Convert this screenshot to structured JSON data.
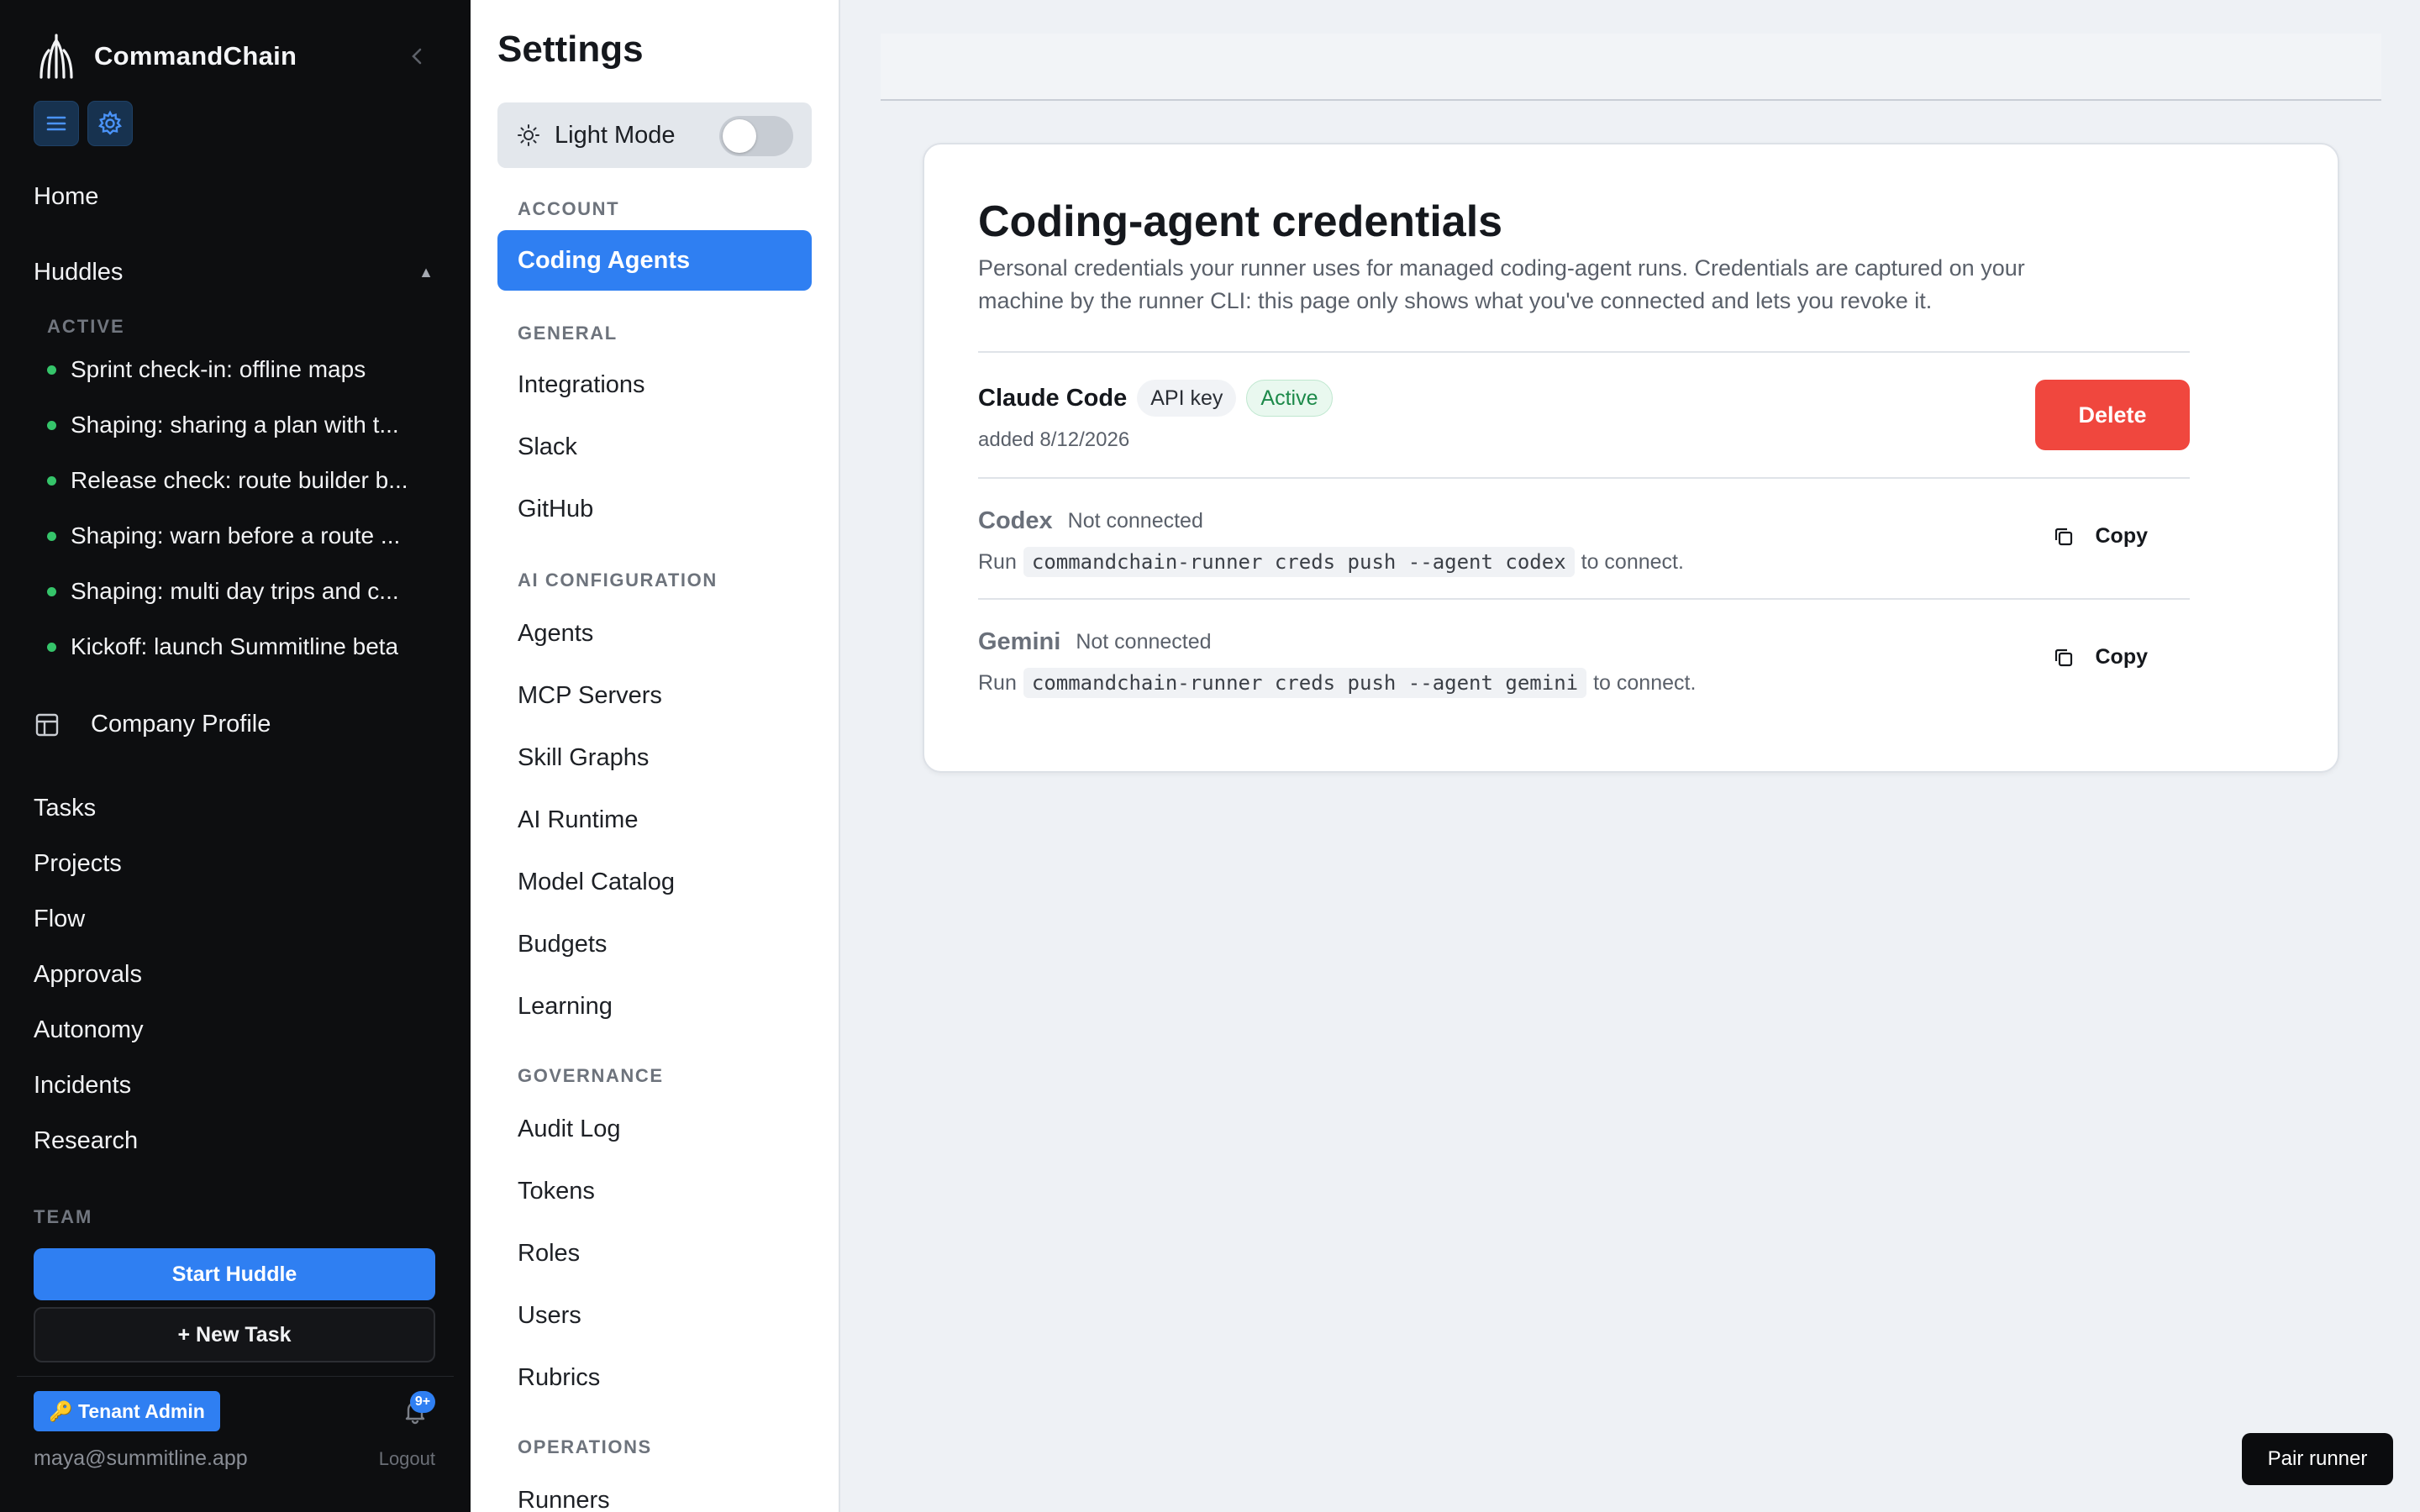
{
  "brand": {
    "name": "CommandChain"
  },
  "sidebar": {
    "home": "Home",
    "huddles": {
      "label": "Huddles",
      "active_caption": "ACTIVE"
    },
    "huddle_items": [
      "Sprint check-in: offline maps",
      "Shaping: sharing a plan with t...",
      "Release check: route builder b...",
      "Shaping: warn before a route ...",
      "Shaping: multi day trips and c...",
      "Kickoff: launch Summitline beta"
    ],
    "company_profile": "Company Profile",
    "nav_items": [
      "Tasks",
      "Projects",
      "Flow",
      "Approvals",
      "Autonomy",
      "Incidents",
      "Research"
    ],
    "team_caption": "TEAM",
    "start_huddle": "Start Huddle",
    "new_task": "+ New Task",
    "tenant_badge": "🔑 Tenant Admin",
    "notification_count": "9+",
    "email": "maya@summitline.app",
    "logout": "Logout"
  },
  "settings": {
    "title": "Settings",
    "mode_label": "Light Mode",
    "account_caption": "ACCOUNT",
    "active_item": "Coding Agents",
    "general_caption": "GENERAL",
    "general_items": [
      "Integrations",
      "Slack",
      "GitHub"
    ],
    "ai_caption": "AI CONFIGURATION",
    "ai_items": [
      "Agents",
      "MCP Servers",
      "Skill Graphs",
      "AI Runtime",
      "Model Catalog",
      "Budgets",
      "Learning"
    ],
    "governance_caption": "GOVERNANCE",
    "governance_items": [
      "Audit Log",
      "Tokens",
      "Roles",
      "Users",
      "Rubrics"
    ],
    "operations_caption": "OPERATIONS",
    "operations_items": [
      "Runners"
    ]
  },
  "main": {
    "title": "Coding-agent credentials",
    "description": "Personal credentials your runner uses for managed coding-agent runs. Credentials are captured on your machine by the runner CLI: this page only shows what you've connected and lets you revoke it.",
    "credentials": [
      {
        "name": "Claude Code",
        "type": "API key",
        "status": "Active",
        "added": "added 8/12/2026",
        "action": "Delete"
      },
      {
        "name": "Codex",
        "status": "Not connected",
        "run_prefix": "Run",
        "command": "commandchain-runner creds push --agent codex",
        "run_suffix": "to connect.",
        "action": "Copy"
      },
      {
        "name": "Gemini",
        "status": "Not connected",
        "run_prefix": "Run",
        "command": "commandchain-runner creds push --agent gemini",
        "run_suffix": "to connect.",
        "action": "Copy"
      }
    ]
  },
  "pair_runner": "Pair runner",
  "colors": {
    "accent": "#2f7ff2",
    "danger": "#f0473e",
    "sidebar_bg": "#0d0e10",
    "active_dot": "#35c46a"
  }
}
